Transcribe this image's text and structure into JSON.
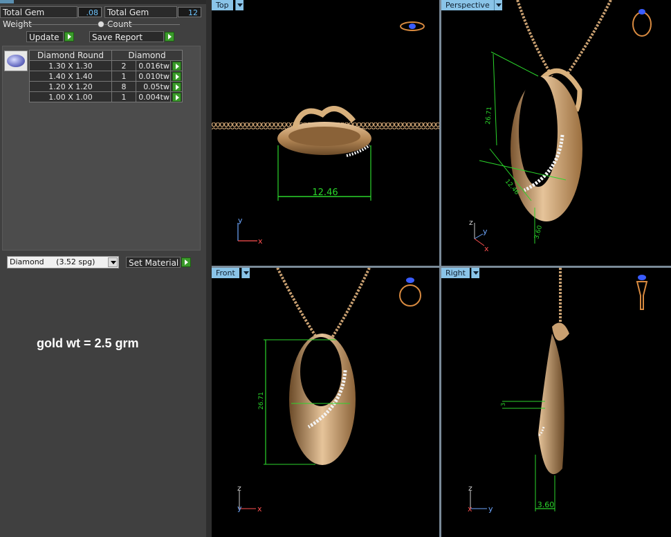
{
  "stats": {
    "total_weight_label": "Total Gem Weight",
    "total_weight_value": ".08",
    "total_count_label": "Total Gem Count",
    "total_count_value": "12"
  },
  "buttons": {
    "update": "Update",
    "save_report": "Save Report",
    "set_material": "Set Material"
  },
  "gem_table": {
    "headers": [
      "Diamond Round",
      "Diamond"
    ],
    "rows": [
      {
        "size": "1.30 X 1.30",
        "count": "2",
        "weight": "0.016tw"
      },
      {
        "size": "1.40 X 1.40",
        "count": "1",
        "weight": "0.010tw"
      },
      {
        "size": "1.20 X 1.20",
        "count": "8",
        "weight": "0.05tw"
      },
      {
        "size": "1.00 X 1.00",
        "count": "1",
        "weight": "0.004tw"
      }
    ]
  },
  "material": {
    "selected": "Diamond     (3.52 spg)"
  },
  "note": "gold wt = 2.5 grm",
  "viewports": {
    "top": {
      "label": "Top",
      "dimension": "12.46",
      "axis_y": "y",
      "axis_x": "x"
    },
    "perspective": {
      "label": "Perspective",
      "dim_a": "26.71",
      "dim_b": "12.46",
      "dim_c": "3.60",
      "axis_z": "z",
      "axis_y": "y",
      "axis_x": "x"
    },
    "front": {
      "label": "Front",
      "dimension": "26.71",
      "axis_z": "z",
      "axis_y": "y",
      "axis_x": "x"
    },
    "right": {
      "label": "Right",
      "dimension": "3.60",
      "small_dim": "3",
      "axis_z": "z",
      "axis_x": "x",
      "axis_y": "y"
    }
  },
  "colors": {
    "gold": "#c9a071",
    "dimension_line": "#2bd62b",
    "accent_button": "#3a9a2a"
  }
}
